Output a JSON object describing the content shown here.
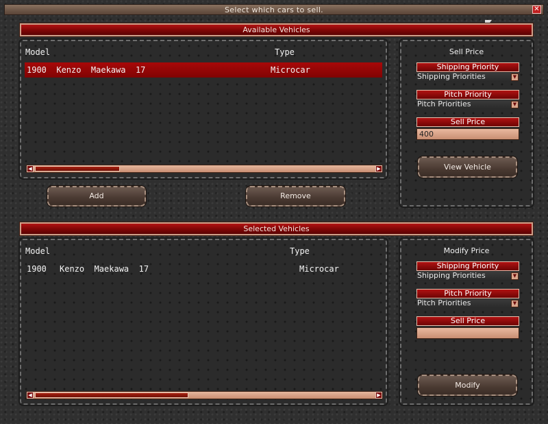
{
  "window": {
    "title": "Select  which  cars  to  sell.",
    "close_icon": "close-icon",
    "close_glyph": "✕"
  },
  "available": {
    "header": "Available  Vehicles",
    "columns": {
      "model": "Model",
      "type": "Type"
    },
    "rows": [
      {
        "model": "1900  Kenzo  Maekawa  17",
        "type": "Microcar",
        "selected": true
      }
    ],
    "scroll_fraction": 0.25
  },
  "actions": {
    "add_label": "Add",
    "remove_label": "Remove"
  },
  "sell_side": {
    "title": "Sell  Price",
    "shipping_label": "Shipping  Priority",
    "shipping_value": "Shipping  Priorities",
    "pitch_label": "Pitch  Priority",
    "pitch_value": "Pitch  Priorities",
    "price_label": "Sell  Price",
    "price_value": "400",
    "view_label": "View  Vehicle"
  },
  "selected": {
    "header": "Selected  Vehicles",
    "columns": {
      "model": "Model",
      "type": "Type"
    },
    "rows": [
      {
        "year": "1900",
        "model": "Kenzo  Maekawa  17",
        "type": "Microcar"
      }
    ],
    "scroll_fraction": 0.45
  },
  "modify_side": {
    "title": "Modify  Price",
    "shipping_label": "Shipping  Priority",
    "shipping_value": "Shipping  Priorities",
    "pitch_label": "Pitch  Priority",
    "pitch_value": "Pitch  Priorities",
    "price_label": "Sell  Price",
    "price_value": "",
    "modify_label": "Modify"
  },
  "icons": {
    "scroll_left": "◀",
    "scroll_right": "▶",
    "dropdown": "▼"
  },
  "colors": {
    "accent_red": "#a00a0a",
    "tan": "#d9a58c"
  }
}
